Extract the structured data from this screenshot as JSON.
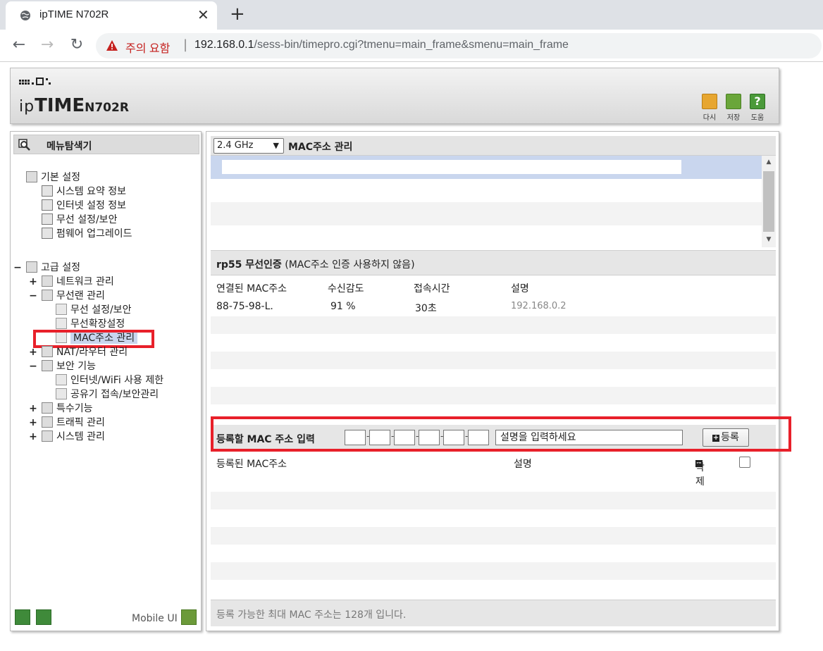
{
  "browser": {
    "tab_title": "ipTIME N702R",
    "security_warning": "주의 요함",
    "url_host": "192.168.0.1",
    "url_path": "/sess-bin/timepro.cgi?tmenu=main_frame&smenu=main_frame"
  },
  "header": {
    "logo_prefix": "ip",
    "logo_brand": "TIME",
    "logo_model": "N702R",
    "buttons": [
      {
        "label": "다시",
        "icon": "refresh-icon",
        "color": "#e7a630"
      },
      {
        "label": "저장",
        "icon": "save-icon",
        "color": "#6aa63a"
      },
      {
        "label": "도움",
        "icon": "help-icon",
        "color": "#4b9a3a"
      }
    ]
  },
  "menu": {
    "search_title": "메뉴탐색기",
    "basic": {
      "label": "기본 설정",
      "items": [
        "시스템 요약 정보",
        "인터넷 설정 정보",
        "무선 설정/보안",
        "펌웨어 업그레이드"
      ]
    },
    "advanced": {
      "label": "고급 설정",
      "network": "네트워크 관리",
      "wireless": "무선랜 관리",
      "wireless_items": [
        "무선 설정/보안",
        "무선확장설정",
        "MAC주소 관리"
      ],
      "nat": "NAT/라우터 관리",
      "security": "보안 기능",
      "security_items": [
        "인터넷/WiFi 사용 제한",
        "공유기 접속/보안관리"
      ],
      "special": "특수기능",
      "traffic": "트래픽 관리",
      "system": "시스템 관리"
    },
    "mobile_ui": "Mobile UI"
  },
  "content": {
    "band_select": "2.4 GHz",
    "title": "MAC주소 관리",
    "auth_title": "rp55 무선인증",
    "auth_note": "(MAC주소 인증 사용하지 않음)",
    "columns": [
      "연결된 MAC주소",
      "수신감도",
      "접속시간",
      "설명"
    ],
    "connected": [
      {
        "mac": "88-75-98-L.",
        "signal": "91 %",
        "time": "30초",
        "desc": "192.168.0.2"
      }
    ],
    "register": {
      "label": "등록할 MAC 주소 입력",
      "desc_placeholder": "설명을 입력하세요",
      "button": "등록"
    },
    "registered_columns": [
      "등록된 MAC주소",
      "설명",
      "삭제"
    ],
    "footer_note": "등록 가능한 최대 MAC 주소는 128개 입니다."
  },
  "colors": {
    "highlight_red": "#e8202a",
    "selection_blue": "#c9d6ee",
    "security_warning": "#c5221f"
  }
}
